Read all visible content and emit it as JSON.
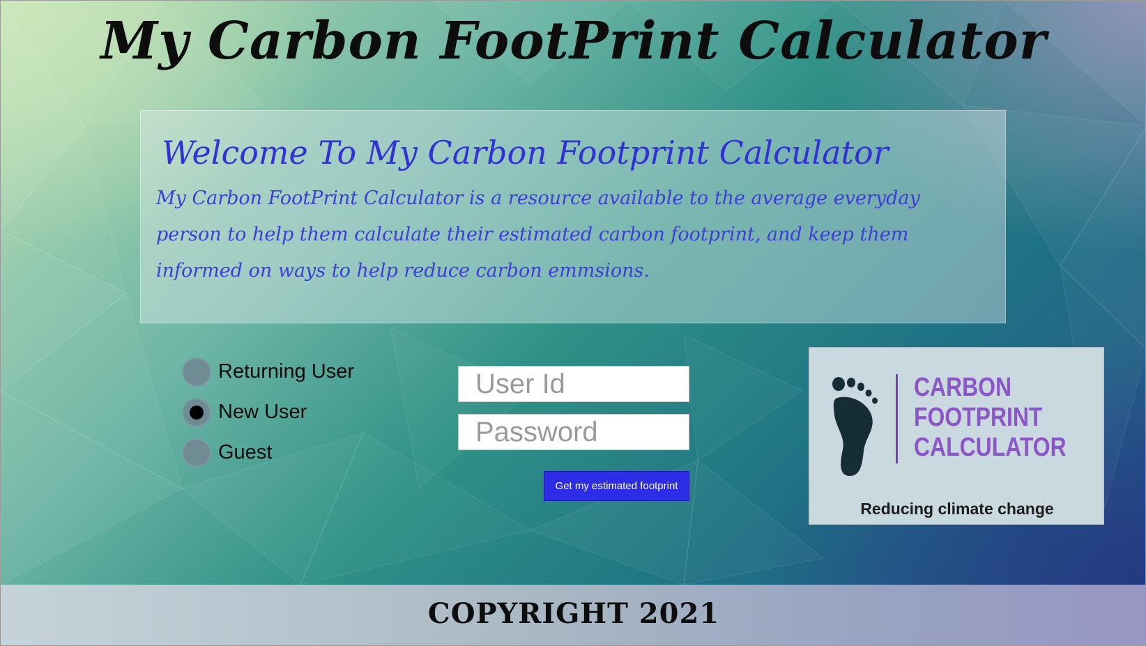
{
  "header": {
    "title": "My Carbon FootPrint Calculator"
  },
  "welcome": {
    "heading": "Welcome To My Carbon Footprint Calculator",
    "body": "My Carbon FootPrint Calculator is a resource available to the average everyday person to help them calculate their estimated carbon footprint, and keep them informed on ways to help reduce carbon emmsions."
  },
  "user_type": {
    "options": [
      {
        "label": "Returning User",
        "checked": false
      },
      {
        "label": "New User",
        "checked": true
      },
      {
        "label": "Guest",
        "checked": false
      }
    ]
  },
  "login": {
    "user_id_placeholder": "User Id",
    "password_placeholder": "Password",
    "submit_label": "Get my estimated footprint"
  },
  "logo": {
    "icon": "footprint-icon",
    "line1": "CARBON",
    "line2": "FOOTPRINT",
    "line3": "CALCULATOR",
    "tagline": "Reducing climate change"
  },
  "footer": {
    "copyright": "COPYRIGHT 2021"
  },
  "colors": {
    "heading_blue": "#3131d6",
    "button_blue": "#2d2de8",
    "logo_purple": "#8c56c8",
    "footprint_dark": "#152d33"
  }
}
